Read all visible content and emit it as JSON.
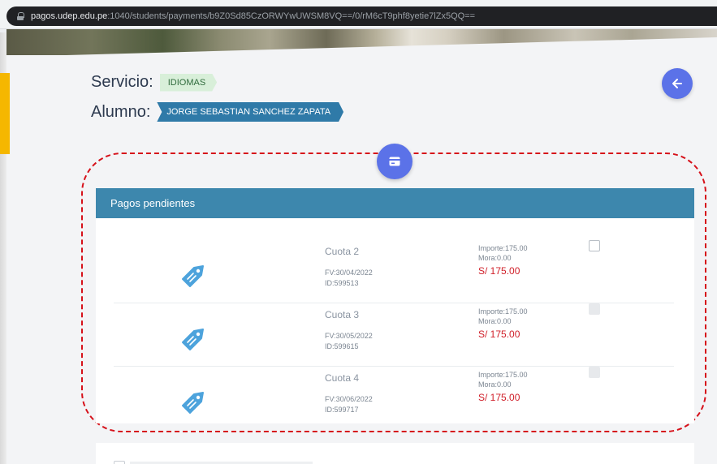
{
  "browser": {
    "url_host": "pagos.udep.edu.pe",
    "url_path": ":1040/students/payments/b9Z0Sd85CzORWYwUWSM8VQ==/0/rM6cT9phf8yetie7lZx5QQ=="
  },
  "header": {
    "servicio_label": "Servicio:",
    "servicio_value": "IDIOMAS",
    "alumno_label": "Alumno:",
    "alumno_value": "JORGE SEBASTIAN SANCHEZ ZAPATA"
  },
  "icons": {
    "back": "arrow-left-icon",
    "payment": "credit-card-icon",
    "cuota": "price-tag-icon",
    "url": "lock-icon"
  },
  "colors": {
    "accent": "#5b72e8",
    "panel_header": "#3d87ad",
    "amount": "#d0202a",
    "highlight_frame": "#d6111a"
  },
  "pagos": {
    "title": "Pagos pendientes",
    "items": [
      {
        "cuota": "Cuota 2",
        "fv": "FV:30/04/2022",
        "id": "ID:599513",
        "importe": "Importe:175.00",
        "mora": "Mora:0.00",
        "total": "S/ 175.00",
        "checkbox_enabled": true
      },
      {
        "cuota": "Cuota 3",
        "fv": "FV:30/05/2022",
        "id": "ID:599615",
        "importe": "Importe:175.00",
        "mora": "Mora:0.00",
        "total": "S/ 175.00",
        "checkbox_enabled": false
      },
      {
        "cuota": "Cuota 4",
        "fv": "FV:30/06/2022",
        "id": "ID:599717",
        "importe": "Importe:175.00",
        "mora": "Mora:0.00",
        "total": "S/ 175.00",
        "checkbox_enabled": false
      }
    ]
  }
}
